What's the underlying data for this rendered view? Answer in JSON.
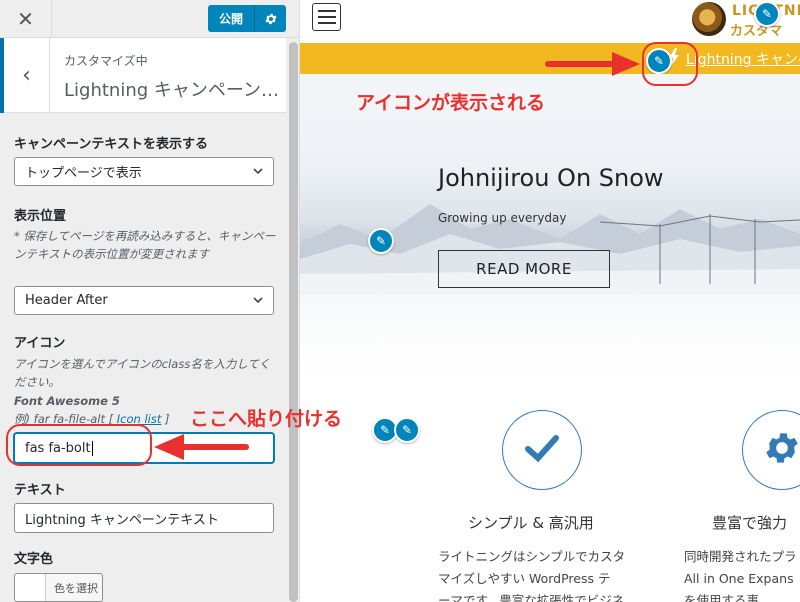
{
  "panel": {
    "close_label": "✕",
    "publish_label": "公開",
    "publish_gear": "gear-icon",
    "back_label": "‹",
    "section_sub": "カスタマイズ中",
    "section_title": "Lightning キャンペーン…"
  },
  "fields": {
    "display_label": "キャンペーンテキストを表示する",
    "display_value": "トップページで表示",
    "position_label": "表示位置",
    "position_desc": "* 保存してページを再読み込みすると、キャンペーンテキストの表示位置が変更されます",
    "position_value": "Header After",
    "icon_label": "アイコン",
    "icon_desc": "アイコンを選んでアイコンのclass名を入力してください。",
    "icon_fa_name": "Font Awesome 5",
    "icon_example": "例) far fa-file-alt [ ",
    "icon_list_link": "Icon list",
    "icon_example_close": " ]",
    "icon_value": "fas fa-bolt",
    "text_label": "テキスト",
    "text_value": "Lightning キャンペーンテキスト",
    "color_label": "文字色",
    "color_button": "色を選択"
  },
  "preview": {
    "logo_line1": "LIGHTNING",
    "logo_line2": "カスタマ",
    "campaign_text": "Lightning キャンペーンテキスト",
    "hero_title": "Johnijirou On Snow",
    "hero_sub": "Growing up everyday",
    "hero_button": "READ MORE",
    "feature1_title": "シンプル & 高汎用",
    "feature1_desc1": "ライトニングはシンプルでカスタ",
    "feature1_desc2": "マイズしやすい WordPress テ",
    "feature1_desc3": "ーマです。豊富な拡張性でビジネ",
    "feature2_title": "豊富で強力",
    "feature2_desc1": "同時開発されたプラ",
    "feature2_desc2": "All in One Expans",
    "feature2_desc3": "を使用する事"
  },
  "annotations": {
    "icon_shown": "アイコンが表示される",
    "paste_here": "ここへ貼り付ける"
  },
  "colors": {
    "accent": "#0085ba",
    "campaign_bar": "#f2b820",
    "annotation_red": "#e8312f"
  }
}
